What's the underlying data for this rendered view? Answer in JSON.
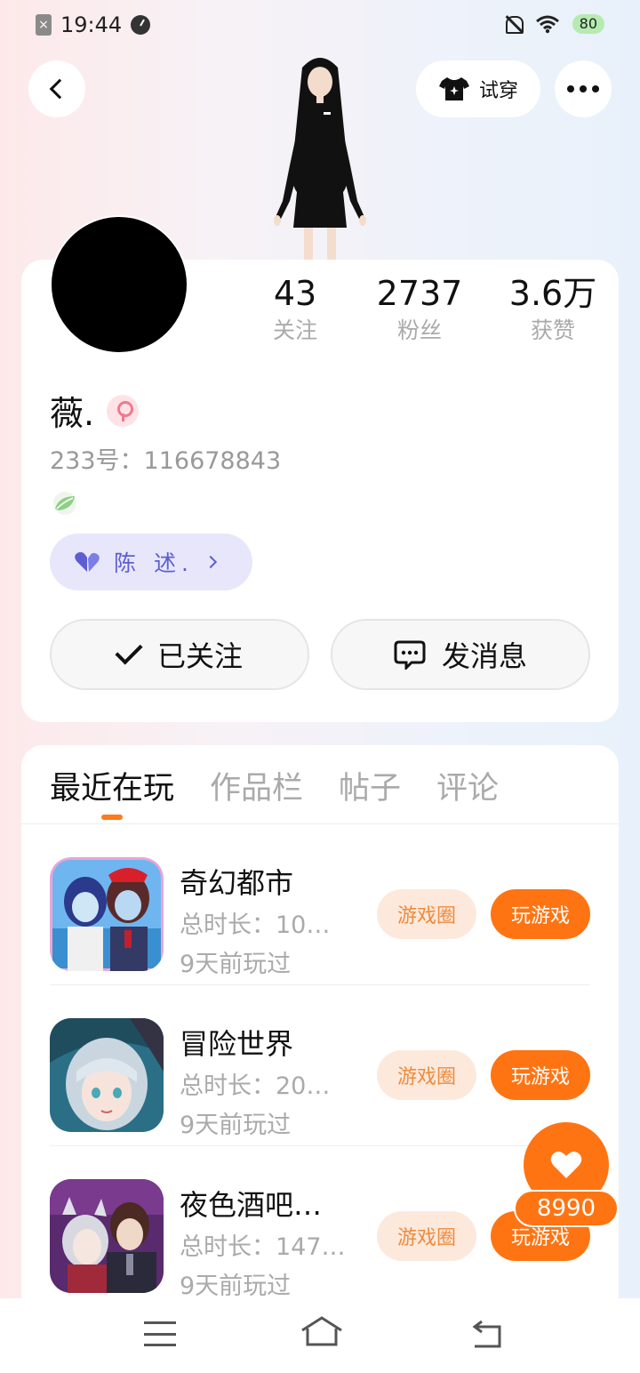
{
  "status_bar": {
    "time": "19:44",
    "battery": "80"
  },
  "header": {
    "tryon_label": "试穿"
  },
  "profile": {
    "stats": [
      {
        "value": "43",
        "label": "关注"
      },
      {
        "value": "2737",
        "label": "粉丝"
      },
      {
        "value": "3.6万",
        "label": "获赞"
      }
    ],
    "name": "薇.",
    "uid": "233号：116678843",
    "couple_name": "陈  述.",
    "follow_label": "已关注",
    "message_label": "发消息"
  },
  "tabs": [
    {
      "label": "最近在玩",
      "active": true
    },
    {
      "label": "作品栏",
      "active": false
    },
    {
      "label": "帖子",
      "active": false
    },
    {
      "label": "评论",
      "active": false
    }
  ],
  "games": [
    {
      "title": "奇幻都市",
      "duration": "总时长：10…",
      "last_played": "9天前玩过",
      "circle_label": "游戏圈",
      "play_label": "玩游戏"
    },
    {
      "title": "冒险世界",
      "duration": "总时长：20…",
      "last_played": "9天前玩过",
      "circle_label": "游戏圈",
      "play_label": "玩游戏"
    },
    {
      "title": "夜色酒吧…",
      "duration": "总时长：147…",
      "last_played": "9天前玩过",
      "circle_label": "游戏圈",
      "play_label": "玩游戏"
    }
  ],
  "like_count": "8990",
  "colors": {
    "accent": "#ff7412",
    "accent_light": "#fde9dc",
    "purple": "#5c5fd2",
    "purple_bg": "#e8e6fb"
  }
}
